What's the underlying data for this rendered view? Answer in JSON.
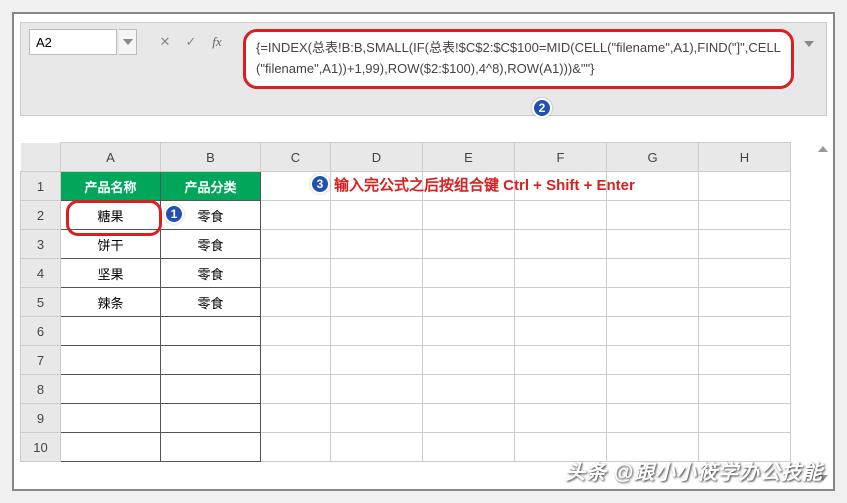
{
  "namebox": {
    "value": "A2"
  },
  "formula_bar": {
    "text": "{=INDEX(总表!B:B,SMALL(IF(总表!$C$2:$C$100=MID(CELL(\"filename\",A1),FIND(\"]\",CELL(\"filename\",A1))+1,99),ROW($2:$100),4^8),ROW(A1)))&\"\"}"
  },
  "columns": [
    "A",
    "B",
    "C",
    "D",
    "E",
    "F",
    "G",
    "H"
  ],
  "rows": [
    "1",
    "2",
    "3",
    "4",
    "5",
    "6",
    "7",
    "8",
    "9",
    "10"
  ],
  "headers": {
    "a1": "产品名称",
    "b1": "产品分类"
  },
  "cells": {
    "a2": "糖果",
    "b2": "零食",
    "a3": "饼干",
    "b3": "零食",
    "a4": "坚果",
    "b4": "零食",
    "a5": "辣条",
    "b5": "零食"
  },
  "badges": {
    "b1": "1",
    "b2": "2",
    "b3": "3"
  },
  "instruction": "输入完公式之后按组合键 Ctrl + Shift + Enter",
  "watermark": "头条 @跟小小筱学办公技能"
}
